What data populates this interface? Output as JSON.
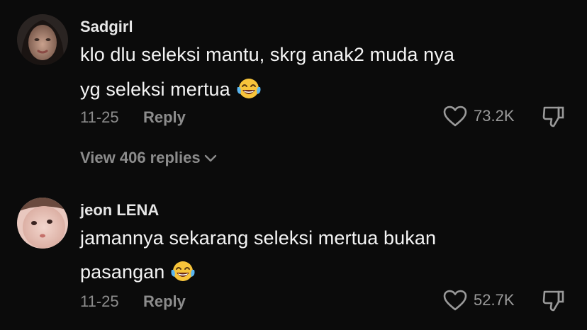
{
  "comments": [
    {
      "username": "Sadgirl",
      "text_line1": "klo dlu seleksi mantu, skrg anak2 muda nya",
      "text_line2": "yg seleksi mertua",
      "emoji": "face-with-tears-of-joy",
      "date": "11-25",
      "reply_label": "Reply",
      "likes": "73.2K",
      "view_replies": "View 406 replies"
    },
    {
      "username": "jeon LENA",
      "text_line1": "jamannya sekarang seleksi mertua bukan",
      "text_line2": "pasangan",
      "emoji": "face-with-tears-of-joy",
      "date": "11-25",
      "reply_label": "Reply",
      "likes": "52.7K"
    }
  ],
  "colors": {
    "background": "#0b0b0b",
    "text": "#f4f4f4",
    "muted": "#8c8c8c"
  }
}
